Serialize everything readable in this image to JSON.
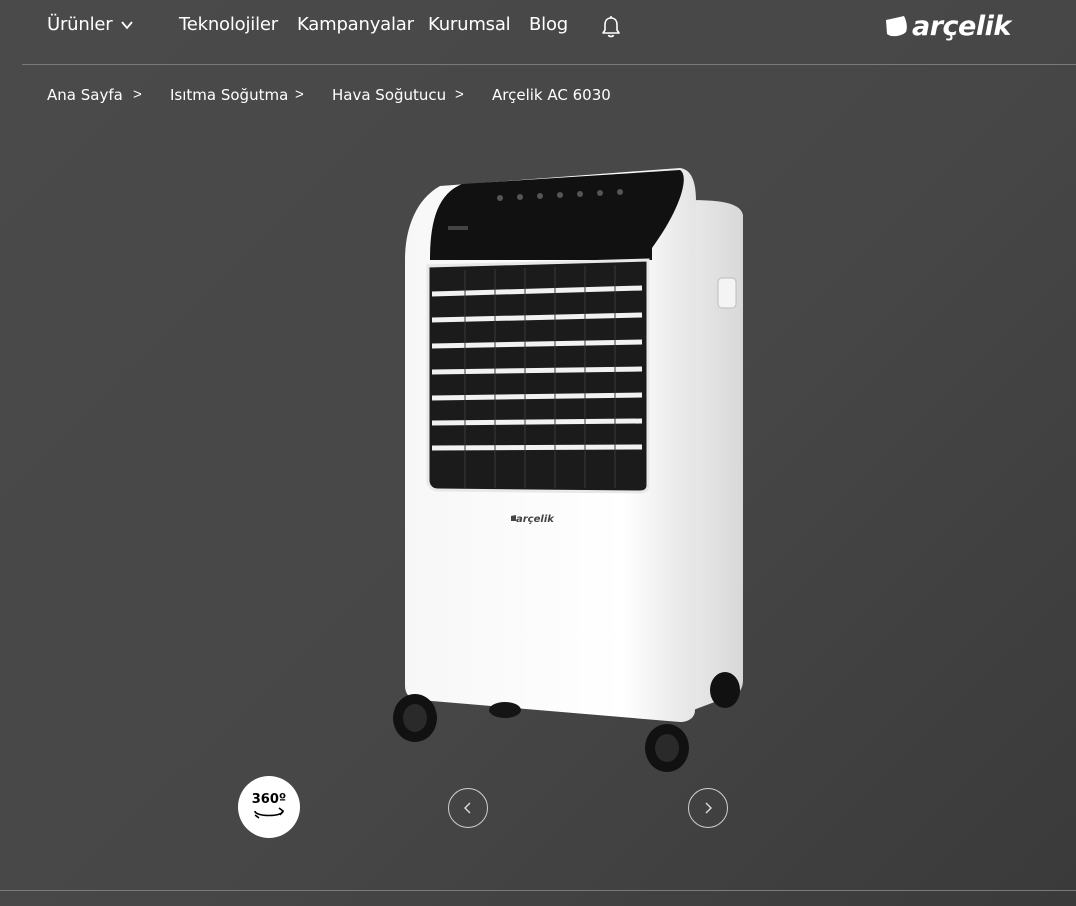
{
  "nav": {
    "products": "Ürünler",
    "technologies": "Teknolojiler",
    "campaigns": "Kampanyalar",
    "corporate": "Kurumsal",
    "blog": "Blog",
    "icons": {
      "products_dropdown": "chevron-down-icon",
      "notifications": "bell-icon"
    }
  },
  "logo": {
    "text": "arçelik"
  },
  "breadcrumb": {
    "items": [
      "Ana Sayfa",
      "Isıtma Soğutma",
      "Hava Soğutucu",
      "Arçelik AC 6030"
    ],
    "separator": ">"
  },
  "product": {
    "brand_mark": "arçelik"
  },
  "gallery": {
    "view_360_label": "360º",
    "icons": {
      "prev": "chevron-left-icon",
      "next": "chevron-right-icon",
      "rotate": "rotate-icon"
    }
  },
  "colors": {
    "background": "#474747",
    "text": "#ffffff",
    "divider": "#7a7a7a"
  }
}
